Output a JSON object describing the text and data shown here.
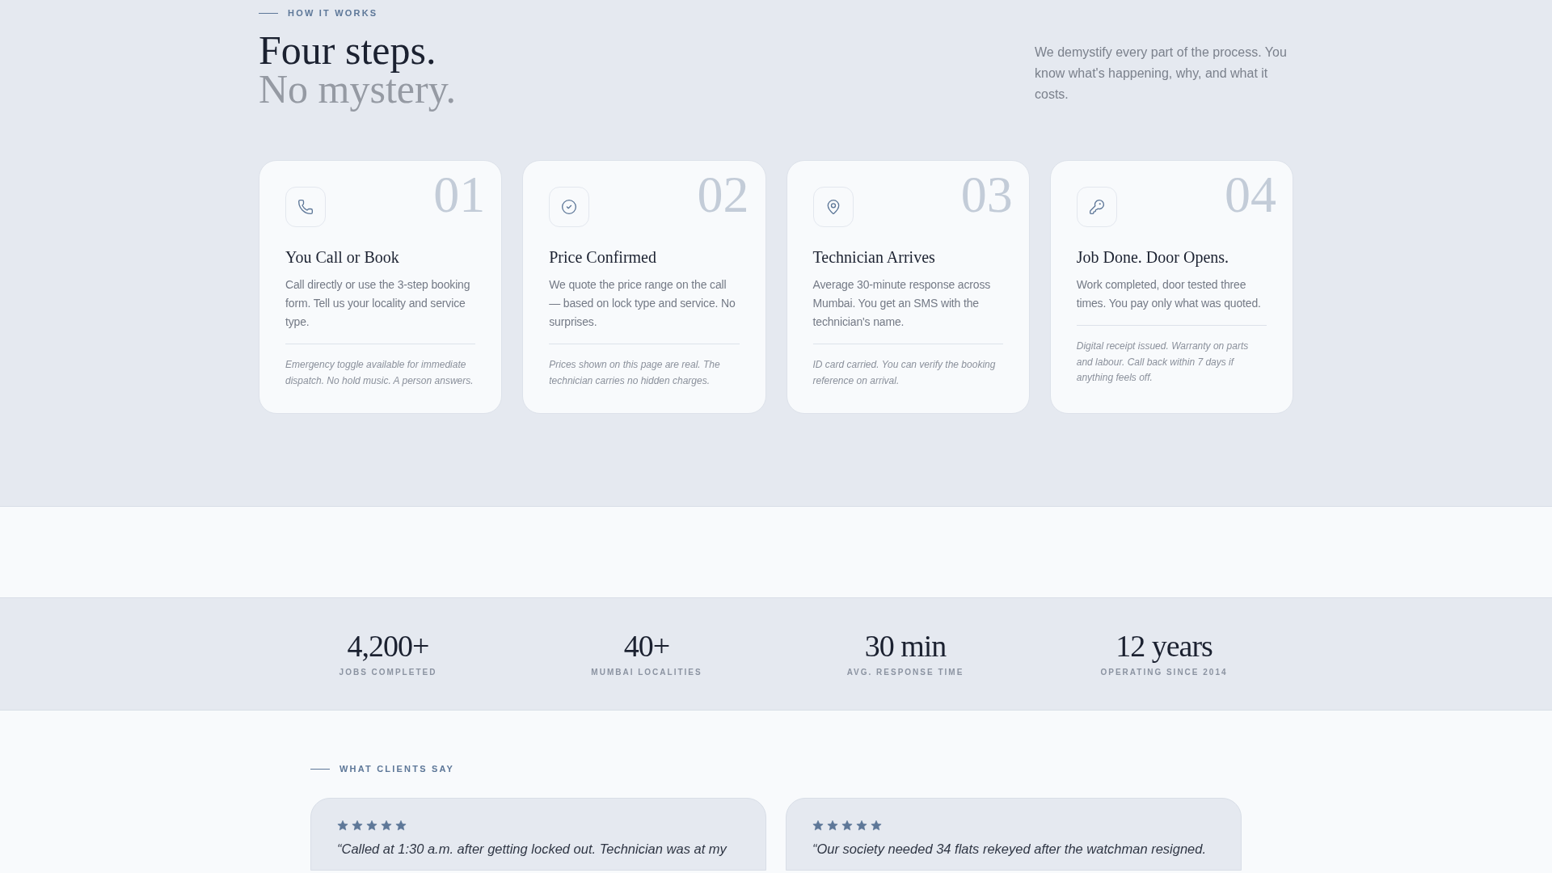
{
  "how_it_works": {
    "eyebrow": "HOW IT WORKS",
    "title": "Four steps.",
    "subtitle": "No mystery.",
    "intro": "We demystify every part of the process. You know what's happening, why, and what it costs.",
    "steps": [
      {
        "number": "01",
        "kind": "phone",
        "title": "You Call or Book",
        "body": "Call directly or use the 3-step booking form. Tell us your locality and service type.",
        "note": "Emergency toggle available for immediate dispatch. No hold music. A person answers."
      },
      {
        "number": "02",
        "kind": "check",
        "title": "Price Confirmed",
        "body": "We quote the price range on the call — based on lock type and service. No surprises.",
        "note": "Prices shown on this page are real. The technician carries no hidden charges."
      },
      {
        "number": "03",
        "kind": "pin",
        "title": "Technician Arrives",
        "body": "Average 30-minute response across Mumbai. You get an SMS with the technician's name.",
        "note": "ID card carried. You can verify the booking reference on arrival."
      },
      {
        "number": "04",
        "kind": "key",
        "title": "Job Done. Door Opens.",
        "body": "Work completed, door tested three times. You pay only what was quoted.",
        "note": "Digital receipt issued. Warranty on parts and labour. Call back within 7 days if anything feels off."
      }
    ]
  },
  "stats": [
    {
      "value": "4,200+",
      "label": "JOBS COMPLETED"
    },
    {
      "value": "40+",
      "label": "MUMBAI LOCALITIES"
    },
    {
      "value": "30 min",
      "label": "AVG. RESPONSE TIME"
    },
    {
      "value": "12 years",
      "label": "OPERATING SINCE 2014"
    }
  ],
  "testimonials": {
    "eyebrow": "WHAT CLIENTS SAY",
    "items": [
      {
        "stars": 5,
        "quote": "“Called at 1:30 a.m. after getting locked out. Technician was at my"
      },
      {
        "stars": 5,
        "quote": "“Our society needed 34 flats rekeyed after the watchman resigned."
      }
    ]
  }
}
